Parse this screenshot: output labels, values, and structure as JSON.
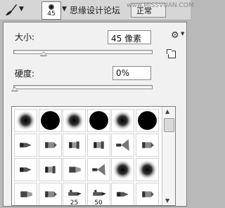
{
  "toolbar": {
    "preset_size": "45",
    "watermark": "思缘设计论坛",
    "watermark_url": "www.MISSVUAN.COM",
    "mode_label": "正常"
  },
  "panel": {
    "size_label": "大小:",
    "size_value": "45 像素",
    "size_fraction": 0.22,
    "hardness_label": "硬度:",
    "hardness_value": "0%",
    "hardness_fraction": 0.0
  },
  "brush_grid": {
    "cells": [
      {
        "icon": "soft-round-brush-icon"
      },
      {
        "icon": "hard-round-brush-icon"
      },
      {
        "icon": "soft-round-brush-icon"
      },
      {
        "icon": "hard-round-brush-icon"
      },
      {
        "icon": "soft-round-brush-icon"
      },
      {
        "icon": "hard-round-brush-icon"
      },
      {
        "icon": "pen-tip-brush-icon"
      },
      {
        "icon": "pencil-brush-icon"
      },
      {
        "icon": "flat-brush-icon"
      },
      {
        "icon": "flat-brush-icon"
      },
      {
        "icon": "fan-brush-icon"
      },
      {
        "icon": "pencil-brush-icon"
      },
      {
        "icon": "pen-tip-brush-icon"
      },
      {
        "icon": "flat-brush-icon"
      },
      {
        "icon": "chisel-brush-icon"
      },
      {
        "icon": "fan-brush-icon"
      },
      {
        "icon": "soft-round-brush-icon"
      },
      {
        "icon": "soft-round-brush-icon"
      },
      {
        "icon": "chisel-brush-icon"
      },
      {
        "icon": "pencil-brush-icon"
      },
      {
        "icon": "airbrush-icon",
        "label": "25"
      },
      {
        "icon": "airbrush-icon",
        "label": "50"
      },
      {
        "icon": "pen-tip-brush-icon"
      },
      {
        "icon": "pencil-brush-icon"
      }
    ]
  }
}
